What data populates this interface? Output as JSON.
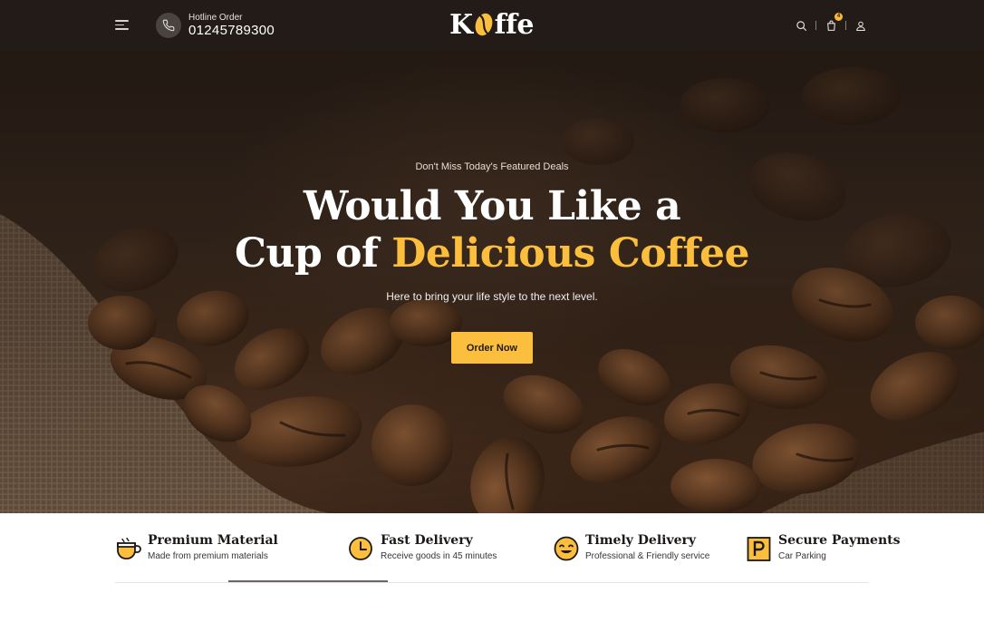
{
  "header": {
    "hotline_label": "Hotline Order",
    "hotline_number": "01245789300",
    "logo_text_left": "K",
    "logo_text_right": "ffe",
    "cart_count": "4"
  },
  "hero": {
    "eyebrow": "Don't Miss Today's Featured Deals",
    "headline_line1": "Would You Like a",
    "headline_line2_plain": "Cup of ",
    "headline_line2_accent": "Delicious Coffee",
    "subline": "Here to bring your life style to the next level.",
    "cta_label": "Order Now"
  },
  "features": [
    {
      "title": "Premium Material",
      "desc": "Made from premium materials",
      "icon": "coffee-cup-icon"
    },
    {
      "title": "Fast Delivery",
      "desc": "Receive goods in 45 minutes",
      "icon": "clock-icon"
    },
    {
      "title": "Timely Delivery",
      "desc": "Professional & Friendly service",
      "icon": "smiley-icon"
    },
    {
      "title": "Secure Payments",
      "desc": "Car Parking",
      "icon": "parking-icon"
    }
  ],
  "colors": {
    "header_bg": "#221b18",
    "accent": "#fbbf3d",
    "text_dark": "#1c1816"
  }
}
